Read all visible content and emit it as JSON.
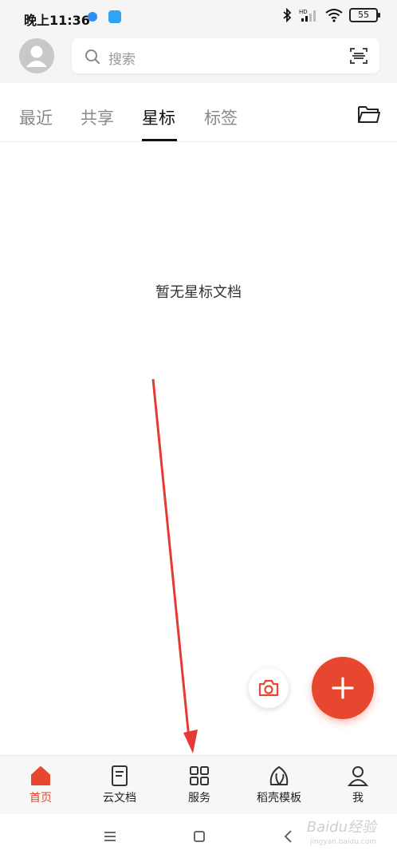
{
  "status_bar": {
    "time": "晚上11:36",
    "battery": "55"
  },
  "search": {
    "placeholder": "搜索"
  },
  "tabs": [
    {
      "label": "最近",
      "active": false
    },
    {
      "label": "共享",
      "active": false
    },
    {
      "label": "星标",
      "active": true
    },
    {
      "label": "标签",
      "active": false
    }
  ],
  "content": {
    "empty_message": "暂无星标文档"
  },
  "bottom_nav": [
    {
      "label": "首页",
      "icon": "home-icon",
      "active": true
    },
    {
      "label": "云文档",
      "icon": "cloud-doc-icon",
      "active": false
    },
    {
      "label": "服务",
      "icon": "grid-icon",
      "active": false
    },
    {
      "label": "稻壳模板",
      "icon": "leaf-icon",
      "active": false
    },
    {
      "label": "我",
      "icon": "person-icon",
      "active": false
    }
  ],
  "watermark": {
    "text": "Baidu经验",
    "sub": "jingyan.baidu.com"
  },
  "colors": {
    "accent": "#e8472f",
    "annotation_arrow": "#e53935"
  }
}
